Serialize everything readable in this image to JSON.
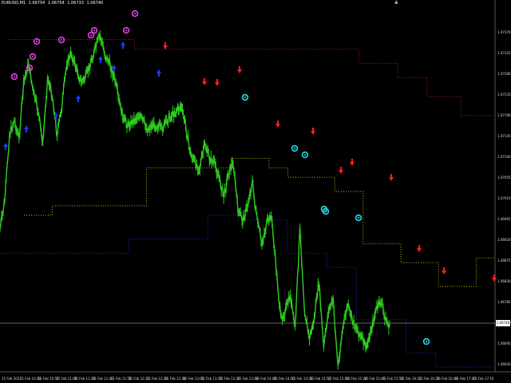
{
  "window": {
    "symbol": "EURUSD,M1",
    "open": "1.06754",
    "high": "1.06754",
    "low": "1.06733",
    "close": "1.06740",
    "close_glyph": "▲"
  },
  "price_axis": {
    "labels": [
      "1.07370",
      "1.07325",
      "1.07280",
      "1.07235",
      "1.07190",
      "1.07145",
      "1.07100",
      "1.07055",
      "1.07010",
      "1.06965",
      "1.06920",
      "1.06875",
      "1.06830",
      "1.06785",
      "1.06740",
      "1.06695",
      "1.06650"
    ],
    "current_price": "1.06740"
  },
  "time_axis": {
    "labels": [
      "15 Feb 2023",
      "15 Feb 10:36",
      "15 Feb 10:52",
      "15 Feb 11:08",
      "15 Feb 11:24",
      "15 Feb 11:40",
      "15 Feb 11:56",
      "15 Feb 12:12",
      "15 Feb 12:28",
      "15 Feb 12:44",
      "15 Feb 13:00",
      "15 Feb 13:16",
      "15 Feb 13:32",
      "15 Feb 13:48",
      "15 Feb 14:04",
      "15 Feb 14:20",
      "15 Feb 14:36",
      "15 Feb 14:52",
      "15 Feb 15:08",
      "15 Feb 15:24",
      "15 Feb 15:40",
      "15 Feb 15:56",
      "15 Feb 16:12",
      "15 Feb 16:28",
      "15 Feb 16:44",
      "15 Feb 17:00",
      "15 Feb 17:16"
    ]
  },
  "colors": {
    "background": "#000000",
    "candles": "#2ecc1f",
    "upper_band": "#b22222",
    "middle_band": "#c8b400",
    "lower_band": "#2828c8",
    "buy_arrow": "#1e3cff",
    "sell_arrow": "#ff1e1e",
    "top_marker": "#e040e0",
    "bottom_marker": "#2ad8e8",
    "current_price_line": "#888888"
  },
  "chart_data": {
    "type": "line",
    "series_kind": "candlestick price line with channel bands and signal arrows",
    "y_range": [
      1.0665,
      1.0741
    ],
    "x_range": [
      "15 Feb 10:20",
      "15 Feb 17:16"
    ],
    "grid": false,
    "price_path": [
      [
        "10:20",
        1.0695
      ],
      [
        "10:24",
        1.0701
      ],
      [
        "10:28",
        1.0715
      ],
      [
        "10:32",
        1.0718
      ],
      [
        "10:36",
        1.0714
      ],
      [
        "10:40",
        1.0726
      ],
      [
        "10:44",
        1.073
      ],
      [
        "10:48",
        1.0724
      ],
      [
        "10:52",
        1.072
      ],
      [
        "10:56",
        1.0713
      ],
      [
        "11:00",
        1.0727
      ],
      [
        "11:04",
        1.0723
      ],
      [
        "11:08",
        1.0715
      ],
      [
        "11:12",
        1.0721
      ],
      [
        "11:16",
        1.073
      ],
      [
        "11:20",
        1.0732
      ],
      [
        "11:24",
        1.0729
      ],
      [
        "11:28",
        1.0726
      ],
      [
        "11:32",
        1.0727
      ],
      [
        "11:36",
        1.073
      ],
      [
        "11:40",
        1.0733
      ],
      [
        "11:44",
        1.0736
      ],
      [
        "11:48",
        1.0732
      ],
      [
        "11:52",
        1.073
      ],
      [
        "11:56",
        1.0727
      ],
      [
        "12:00",
        1.0722
      ],
      [
        "12:04",
        1.0718
      ],
      [
        "12:08",
        1.0717
      ],
      [
        "12:12",
        1.0718
      ],
      [
        "12:16",
        1.0719
      ],
      [
        "12:20",
        1.0718
      ],
      [
        "12:24",
        1.0716
      ],
      [
        "12:28",
        1.0717
      ],
      [
        "12:32",
        1.0717
      ],
      [
        "12:36",
        1.0716
      ],
      [
        "12:40",
        1.0718
      ],
      [
        "12:44",
        1.0719
      ],
      [
        "12:48",
        1.072
      ],
      [
        "12:52",
        1.0721
      ],
      [
        "12:56",
        1.0717
      ],
      [
        "13:00",
        1.0711
      ],
      [
        "13:04",
        1.0709
      ],
      [
        "13:08",
        1.0708
      ],
      [
        "13:12",
        1.0713
      ],
      [
        "13:16",
        1.071
      ],
      [
        "13:20",
        1.0709
      ],
      [
        "13:24",
        1.0706
      ],
      [
        "13:28",
        1.0702
      ],
      [
        "13:32",
        1.0707
      ],
      [
        "13:36",
        1.0709
      ],
      [
        "13:40",
        1.0699
      ],
      [
        "13:44",
        1.0697
      ],
      [
        "13:48",
        1.07
      ],
      [
        "13:52",
        1.0705
      ],
      [
        "13:56",
        1.0697
      ],
      [
        "14:00",
        1.0692
      ],
      [
        "14:04",
        1.0696
      ],
      [
        "14:08",
        1.0698
      ],
      [
        "14:12",
        1.0687
      ],
      [
        "14:16",
        1.0676
      ],
      [
        "14:20",
        1.0678
      ],
      [
        "14:24",
        1.0681
      ],
      [
        "14:28",
        1.0674
      ],
      [
        "14:32",
        1.0695
      ],
      [
        "14:36",
        1.0678
      ],
      [
        "14:40",
        1.0672
      ],
      [
        "14:44",
        1.0676
      ],
      [
        "14:48",
        1.0684
      ],
      [
        "14:52",
        1.067
      ],
      [
        "14:56",
        1.0678
      ],
      [
        "15:00",
        1.068
      ],
      [
        "15:04",
        1.0666
      ],
      [
        "15:08",
        1.0674
      ],
      [
        "15:12",
        1.0679
      ],
      [
        "15:16",
        1.0676
      ],
      [
        "15:20",
        1.0674
      ],
      [
        "15:24",
        1.0672
      ],
      [
        "15:28",
        1.067
      ],
      [
        "15:32",
        1.0674
      ],
      [
        "15:36",
        1.0678
      ],
      [
        "15:40",
        1.068
      ],
      [
        "15:44",
        1.0676
      ],
      [
        "15:48",
        1.0674
      ]
    ],
    "bands": {
      "upper_start": 1.0737,
      "upper_end": 1.0719,
      "middle_start": 1.0715,
      "middle_end": 1.0689,
      "lower_start": 1.07,
      "lower_end": 1.0666
    },
    "signals": {
      "buy_arrows": 8,
      "sell_arrows": 16,
      "top_markers": 9,
      "bottom_markers": 7
    },
    "current_price": 1.0674
  }
}
